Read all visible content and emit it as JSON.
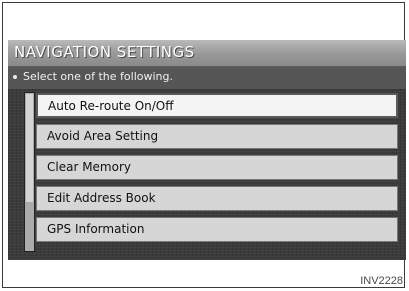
{
  "screen": {
    "title": "NAVIGATION SETTINGS",
    "instruction": "Select one of the following.",
    "menu_items": [
      {
        "label": "Auto Re-route On/Off",
        "highlighted": true
      },
      {
        "label": "Avoid Area Setting",
        "highlighted": false
      },
      {
        "label": "Clear Memory",
        "highlighted": false
      },
      {
        "label": "Edit Address Book",
        "highlighted": false
      },
      {
        "label": "GPS Information",
        "highlighted": false
      }
    ]
  },
  "caption": "INV2228"
}
